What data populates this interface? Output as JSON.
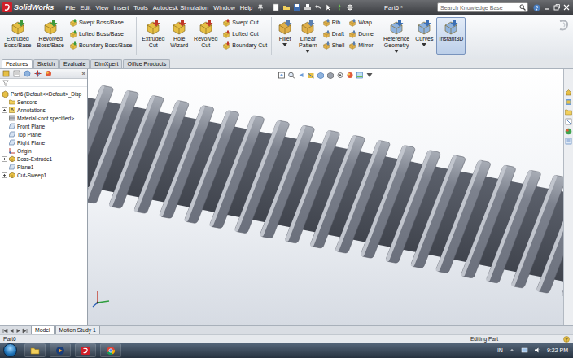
{
  "window": {
    "logo": "SolidWorks",
    "title": "Part6 *"
  },
  "menu": [
    "File",
    "Edit",
    "View",
    "Insert",
    "Tools",
    "Autodesk Simulation",
    "Window",
    "Help"
  ],
  "search": {
    "placeholder": "Search Knowledge Base"
  },
  "ribbon": {
    "groups": [
      {
        "items": [
          {
            "kind": "large",
            "label": "Extruded Boss/Base",
            "dropdown": false,
            "selected": false
          },
          {
            "kind": "large",
            "label": "Revolved Boss/Base",
            "dropdown": false,
            "selected": false
          },
          {
            "kind": "stack",
            "entries": [
              {
                "label": "Swept Boss/Base"
              },
              {
                "label": "Lofted Boss/Base"
              },
              {
                "label": "Boundary Boss/Base"
              }
            ]
          }
        ]
      },
      {
        "items": [
          {
            "kind": "large",
            "label": "Extruded Cut",
            "dropdown": false,
            "selected": false
          },
          {
            "kind": "large",
            "label": "Hole Wizard",
            "dropdown": false,
            "selected": false
          },
          {
            "kind": "large",
            "label": "Revolved Cut",
            "dropdown": false,
            "selected": false
          },
          {
            "kind": "stack",
            "entries": [
              {
                "label": "Swept Cut"
              },
              {
                "label": "Lofted Cut"
              },
              {
                "label": "Boundary Cut"
              }
            ]
          }
        ]
      },
      {
        "items": [
          {
            "kind": "large",
            "label": "Fillet",
            "dropdown": true,
            "selected": false
          },
          {
            "kind": "large",
            "label": "Linear Pattern",
            "dropdown": true,
            "selected": false
          },
          {
            "kind": "stack",
            "entries": [
              {
                "label": "Rib"
              },
              {
                "label": "Draft"
              },
              {
                "label": "Shell"
              }
            ]
          },
          {
            "kind": "stack",
            "entries": [
              {
                "label": "Wrap"
              },
              {
                "label": "Dome"
              },
              {
                "label": "Mirror"
              }
            ]
          }
        ]
      },
      {
        "items": [
          {
            "kind": "large",
            "label": "Reference Geometry",
            "dropdown": true,
            "selected": false
          },
          {
            "kind": "large",
            "label": "Curves",
            "dropdown": true,
            "selected": false
          },
          {
            "kind": "large",
            "label": "Instant3D",
            "dropdown": false,
            "selected": true
          }
        ]
      }
    ]
  },
  "command_tabs": [
    {
      "label": "Features",
      "selected": true
    },
    {
      "label": "Sketch",
      "selected": false
    },
    {
      "label": "Evaluate",
      "selected": false
    },
    {
      "label": "DimXpert",
      "selected": false
    },
    {
      "label": "Office Products",
      "selected": false
    }
  ],
  "feature_manager": {
    "expand_glyph": "»",
    "items": [
      {
        "kind": "root",
        "label": "Part6  (Default<<Default>_Disp",
        "expandable": false,
        "expanded": false
      },
      {
        "kind": "folder",
        "label": "Sensors",
        "expandable": false,
        "expanded": false
      },
      {
        "kind": "annotation",
        "label": "Annotations",
        "expandable": true,
        "expanded": false
      },
      {
        "kind": "material",
        "label": "Material <not specified>",
        "expandable": false,
        "expanded": false
      },
      {
        "kind": "plane",
        "label": "Front Plane",
        "expandable": false,
        "expanded": false
      },
      {
        "kind": "plane",
        "label": "Top Plane",
        "expandable": false,
        "expanded": false
      },
      {
        "kind": "plane",
        "label": "Right Plane",
        "expandable": false,
        "expanded": false
      },
      {
        "kind": "origin",
        "label": "Origin",
        "expandable": false,
        "expanded": false
      },
      {
        "kind": "feature",
        "label": "Boss-Extrude1",
        "expandable": true,
        "expanded": false
      },
      {
        "kind": "plane",
        "label": "Plane1",
        "expandable": false,
        "expanded": false
      },
      {
        "kind": "feature",
        "label": "Cut-Sweep1",
        "expandable": true,
        "expanded": false
      }
    ]
  },
  "sheet_tabs": [
    {
      "label": "Model",
      "selected": true
    },
    {
      "label": "Motion Study 1",
      "selected": false
    }
  ],
  "status_bar": {
    "document": "Part6",
    "mode": "Editing Part"
  },
  "taskbar": {
    "language": "IN",
    "clock": "9:22 PM"
  }
}
